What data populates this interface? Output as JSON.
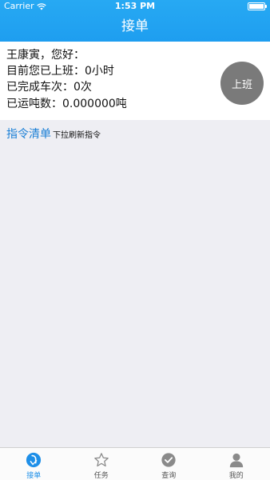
{
  "status_bar": {
    "carrier": "Carrier",
    "time": "1:53 PM"
  },
  "nav": {
    "title": "接单"
  },
  "info": {
    "greeting": "王康寅，您好：",
    "work_hours": "目前您已上班：0小时",
    "trips": "已完成车次：0次",
    "tonnage": "已运吨数：0.000000吨"
  },
  "shift_button": {
    "label": "上班"
  },
  "list": {
    "title": "指令清单",
    "hint": "下拉刷新指令"
  },
  "tabs": [
    {
      "label": "接单",
      "icon": "receive-order-icon",
      "active": true
    },
    {
      "label": "任务",
      "icon": "star-icon",
      "active": false
    },
    {
      "label": "查询",
      "icon": "check-circle-icon",
      "active": false
    },
    {
      "label": "我的",
      "icon": "person-icon",
      "active": false
    }
  ],
  "colors": {
    "accent": "#1e9ef0",
    "tab_active": "#1e8fe8",
    "button_gray": "#7a7a7a"
  }
}
